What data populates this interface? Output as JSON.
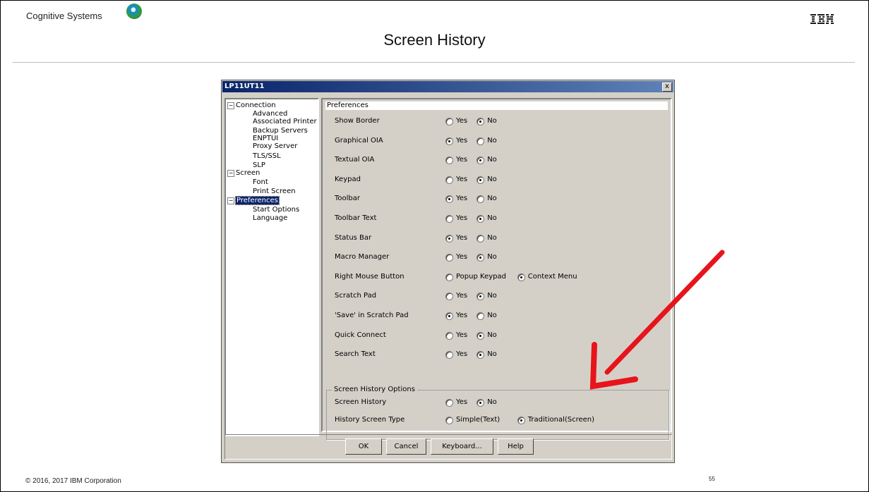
{
  "slide": {
    "brand": "Cognitive Systems",
    "title": "Screen History",
    "footer": "© 2016, 2017 IBM Corporation",
    "page_number": "55",
    "logo": "IBM"
  },
  "dialog": {
    "title": "LP11UT11",
    "close_label": "x",
    "tree": [
      {
        "label": "Connection",
        "toggle": "−"
      },
      {
        "label": "Advanced"
      },
      {
        "label": "Associated Printer"
      },
      {
        "label": "Backup Servers"
      },
      {
        "label": "ENPTUI"
      },
      {
        "label": "Proxy Server"
      },
      {
        "label": "TLS/SSL"
      },
      {
        "label": "SLP"
      },
      {
        "label": "Screen",
        "toggle": "−"
      },
      {
        "label": "Font"
      },
      {
        "label": "Print Screen"
      },
      {
        "label": "Preferences",
        "toggle": "−",
        "selected": true
      },
      {
        "label": "Start Options"
      },
      {
        "label": "Language"
      }
    ],
    "panel_header": "Preferences",
    "settings": [
      {
        "label": "Show Border",
        "options": [
          "Yes",
          "No"
        ],
        "selected": "No"
      },
      {
        "label": "Graphical OIA",
        "options": [
          "Yes",
          "No"
        ],
        "selected": "Yes"
      },
      {
        "label": "Textual OIA",
        "options": [
          "Yes",
          "No"
        ],
        "selected": "No"
      },
      {
        "label": "Keypad",
        "options": [
          "Yes",
          "No"
        ],
        "selected": "No"
      },
      {
        "label": "Toolbar",
        "options": [
          "Yes",
          "No"
        ],
        "selected": "Yes"
      },
      {
        "label": "Toolbar Text",
        "options": [
          "Yes",
          "No"
        ],
        "selected": "No"
      },
      {
        "label": "Status Bar",
        "options": [
          "Yes",
          "No"
        ],
        "selected": "Yes"
      },
      {
        "label": "Macro Manager",
        "options": [
          "Yes",
          "No"
        ],
        "selected": "No"
      },
      {
        "label": "Right Mouse Button",
        "options": [
          "Popup Keypad",
          "Context Menu"
        ],
        "selected": "Context Menu"
      },
      {
        "label": "Scratch Pad",
        "options": [
          "Yes",
          "No"
        ],
        "selected": "No"
      },
      {
        "label": "'Save' in Scratch Pad",
        "options": [
          "Yes",
          "No"
        ],
        "selected": "Yes"
      },
      {
        "label": "Quick Connect",
        "options": [
          "Yes",
          "No"
        ],
        "selected": "No"
      },
      {
        "label": "Search Text",
        "options": [
          "Yes",
          "No"
        ],
        "selected": "No"
      }
    ],
    "history_group": {
      "title": "Screen History Options",
      "settings": [
        {
          "label": "Screen History",
          "options": [
            "Yes",
            "No"
          ],
          "selected": "No"
        },
        {
          "label": "History Screen Type",
          "options": [
            "Simple(Text)",
            "Traditional(Screen)"
          ],
          "selected": "Traditional(Screen)"
        }
      ]
    },
    "buttons": {
      "ok": "OK",
      "cancel": "Cancel",
      "keyboard": "Keyboard...",
      "help": "Help"
    }
  },
  "colors": {
    "arrow": "#e8141b",
    "titlebar": "#0a246a",
    "dialog_bg": "#d4d0c8"
  }
}
